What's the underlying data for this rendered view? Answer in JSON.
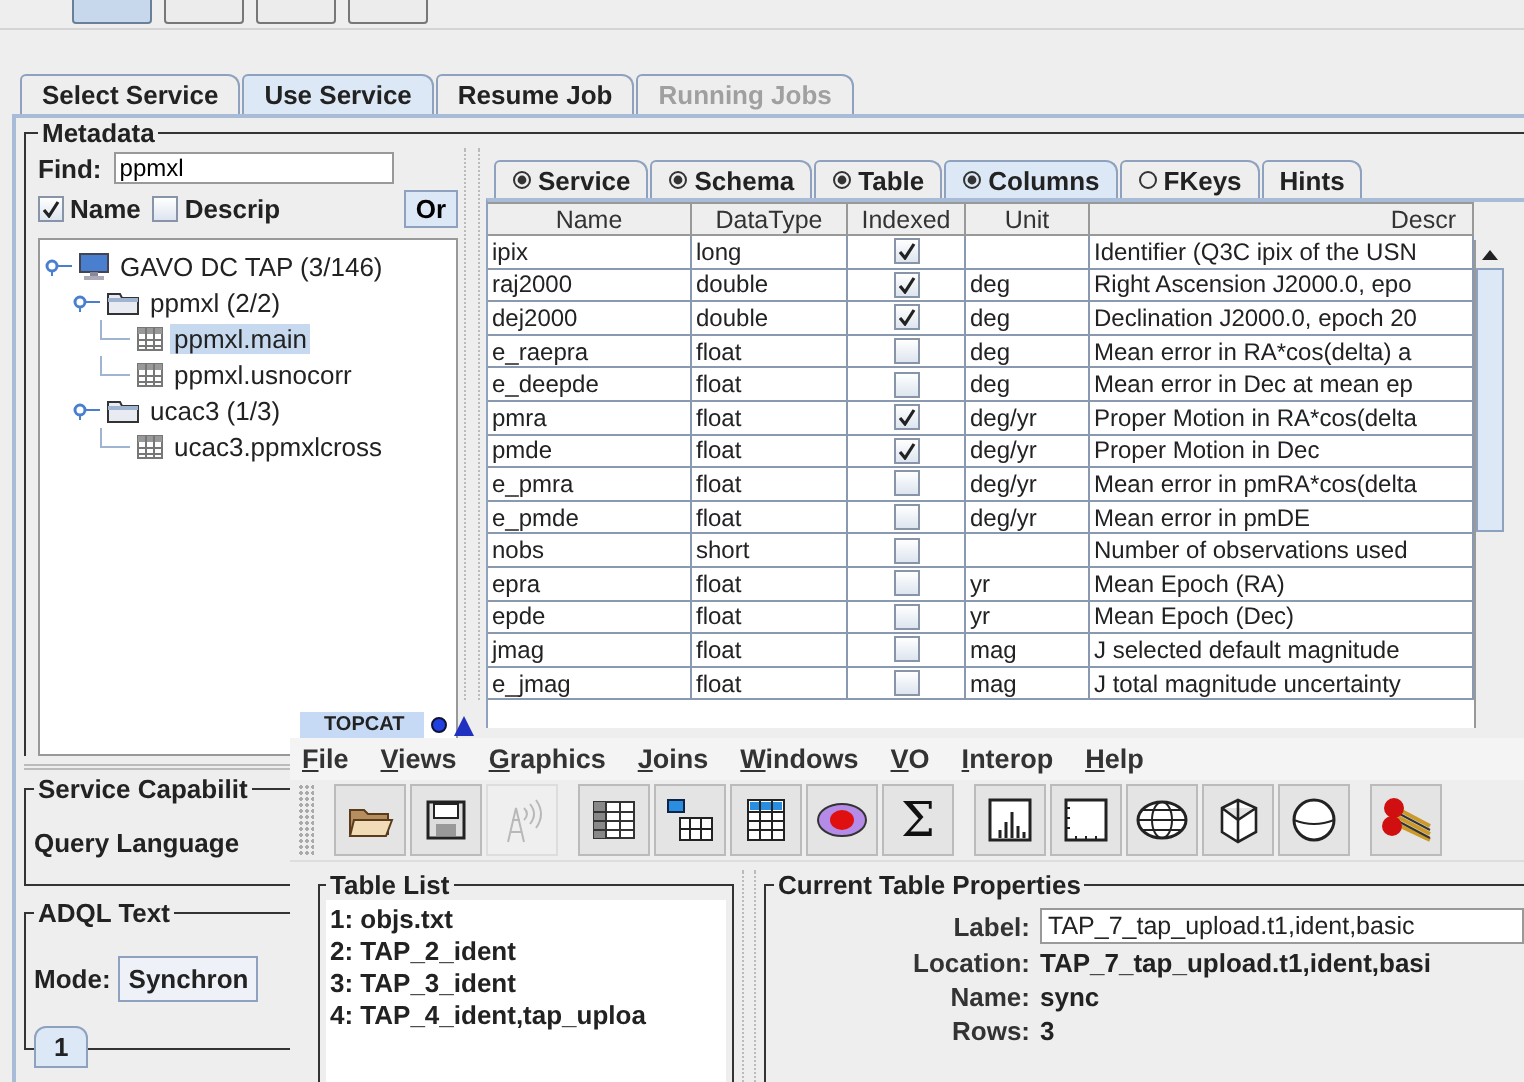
{
  "top_toolbar": [
    {
      "selected": true
    },
    {
      "selected": false
    },
    {
      "selected": false
    },
    {
      "selected": false
    }
  ],
  "tabs": [
    {
      "label": "Select Service",
      "selected": false,
      "disabled": false
    },
    {
      "label": "Use Service",
      "selected": true,
      "disabled": false
    },
    {
      "label": "Resume Job",
      "selected": false,
      "disabled": false
    },
    {
      "label": "Running Jobs",
      "selected": false,
      "disabled": true
    }
  ],
  "metadata": {
    "title": "Metadata",
    "find_label": "Find:",
    "find_value": "ppmxl",
    "options": [
      {
        "label": "Name",
        "checked": true
      },
      {
        "label": "Descrip",
        "checked": false
      }
    ],
    "or_button": "Or",
    "tree": [
      {
        "kind": "service",
        "label": "GAVO DC TAP (3/146)",
        "selected": false,
        "expanded": true,
        "children": [
          {
            "kind": "schema",
            "label": "ppmxl (2/2)",
            "selected": false,
            "expanded": true,
            "children": [
              {
                "kind": "table",
                "label": "ppmxl.main",
                "selected": true
              },
              {
                "kind": "table",
                "label": "ppmxl.usnocorr",
                "selected": false
              }
            ]
          },
          {
            "kind": "schema",
            "label": "ucac3 (1/3)",
            "selected": false,
            "expanded": true,
            "children": [
              {
                "kind": "table",
                "label": "ucac3.ppmxlcross",
                "selected": false
              }
            ]
          }
        ]
      }
    ],
    "subtabs": [
      {
        "label": "Service",
        "loaded": true,
        "selected": false
      },
      {
        "label": "Schema",
        "loaded": true,
        "selected": false
      },
      {
        "label": "Table",
        "loaded": true,
        "selected": false
      },
      {
        "label": "Columns",
        "loaded": true,
        "selected": true
      },
      {
        "label": "FKeys",
        "loaded": false,
        "selected": false
      },
      {
        "label": "Hints",
        "selected": false
      }
    ],
    "columns": [
      "Name",
      "DataType",
      "Indexed",
      "Unit",
      "Descr"
    ],
    "rows": [
      {
        "name": "ipix",
        "type": "long",
        "indexed": true,
        "unit": "",
        "descr": "Identifier (Q3C ipix of the USN"
      },
      {
        "name": "raj2000",
        "type": "double",
        "indexed": true,
        "unit": "deg",
        "descr": "Right Ascension J2000.0, epo"
      },
      {
        "name": "dej2000",
        "type": "double",
        "indexed": true,
        "unit": "deg",
        "descr": "Declination J2000.0, epoch 20"
      },
      {
        "name": "e_raepra",
        "type": "float",
        "indexed": false,
        "unit": "deg",
        "descr": "Mean error in RA*cos(delta) a"
      },
      {
        "name": "e_deepde",
        "type": "float",
        "indexed": false,
        "unit": "deg",
        "descr": "Mean error in Dec at mean ep"
      },
      {
        "name": "pmra",
        "type": "float",
        "indexed": true,
        "unit": "deg/yr",
        "descr": "Proper Motion in RA*cos(delta"
      },
      {
        "name": "pmde",
        "type": "float",
        "indexed": true,
        "unit": "deg/yr",
        "descr": "Proper Motion in Dec"
      },
      {
        "name": "e_pmra",
        "type": "float",
        "indexed": false,
        "unit": "deg/yr",
        "descr": "Mean error in pmRA*cos(delta"
      },
      {
        "name": "e_pmde",
        "type": "float",
        "indexed": false,
        "unit": "deg/yr",
        "descr": "Mean error in pmDE"
      },
      {
        "name": "nobs",
        "type": "short",
        "indexed": false,
        "unit": "",
        "descr": "Number of observations used"
      },
      {
        "name": "epra",
        "type": "float",
        "indexed": false,
        "unit": "yr",
        "descr": "Mean Epoch (RA)"
      },
      {
        "name": "epde",
        "type": "float",
        "indexed": false,
        "unit": "yr",
        "descr": "Mean Epoch (Dec)"
      },
      {
        "name": "jmag",
        "type": "float",
        "indexed": false,
        "unit": "mag",
        "descr": "J selected default magnitude"
      },
      {
        "name": "e_jmag",
        "type": "float",
        "indexed": false,
        "unit": "mag",
        "descr": "J total magnitude uncertainty"
      }
    ]
  },
  "lower": {
    "capabilities_title": "Service Capabilit",
    "query_language": "Query Language",
    "adql_title": "ADQL Text",
    "mode_label": "Mode:",
    "mode_value": "Synchron",
    "tab": "1"
  },
  "topcat": {
    "title": "TOPCAT",
    "menu": [
      "File",
      "Views",
      "Graphics",
      "Joins",
      "Windows",
      "VO",
      "Interop",
      "Help"
    ],
    "toolbar": [
      [
        {
          "kind": "open",
          "disabled": false
        },
        {
          "kind": "save",
          "disabled": false
        },
        {
          "kind": "antenna",
          "disabled": true
        }
      ],
      [
        {
          "kind": "table",
          "disabled": false
        },
        {
          "kind": "subset",
          "disabled": false
        },
        {
          "kind": "columns",
          "disabled": false
        },
        {
          "kind": "ellipse",
          "disabled": false
        },
        {
          "kind": "glyph",
          "glyph": "Σ",
          "disabled": false
        }
      ],
      [
        {
          "kind": "histogram",
          "disabled": false
        },
        {
          "kind": "plot",
          "disabled": false
        },
        {
          "kind": "globe",
          "disabled": false
        },
        {
          "kind": "cube",
          "disabled": false
        },
        {
          "kind": "sphere",
          "disabled": false
        }
      ],
      [
        {
          "kind": "dots",
          "disabled": false
        }
      ]
    ],
    "table_list_title": "Table List",
    "tables": [
      "1: objs.txt",
      "2: TAP_2_ident",
      "3: TAP_3_ident",
      "4: TAP_4_ident,tap_uploa"
    ],
    "props_title": "Current Table Properties",
    "props": [
      {
        "label": "Label:",
        "value": "TAP_7_tap_upload.t1,ident,basic",
        "kind": "field"
      },
      {
        "label": "Location:",
        "value": "TAP_7_tap_upload.t1,ident,basi",
        "kind": "text"
      },
      {
        "label": "Name:",
        "value": "sync",
        "kind": "text"
      },
      {
        "label": "Rows:",
        "value": "3",
        "kind": "text"
      }
    ]
  }
}
